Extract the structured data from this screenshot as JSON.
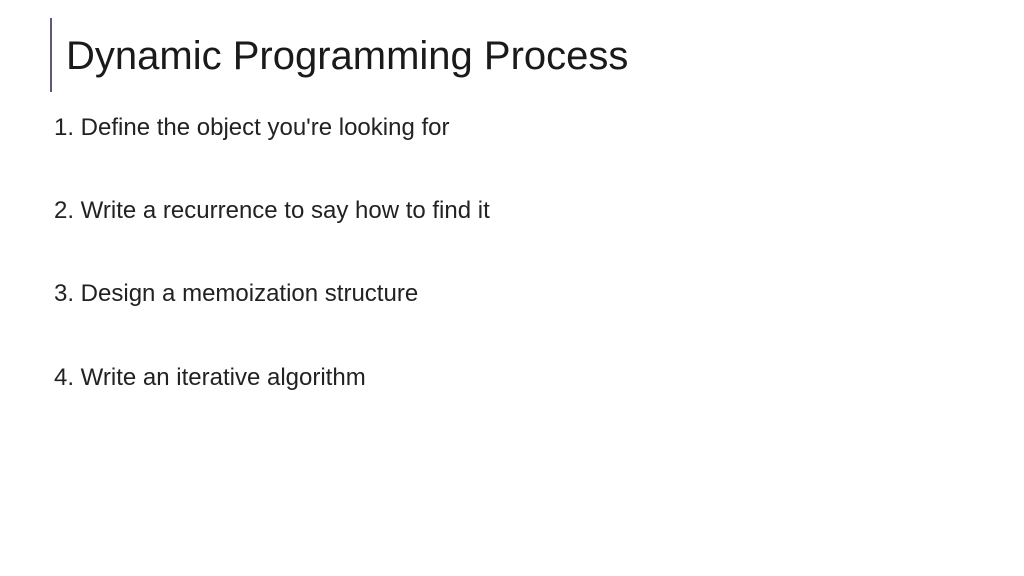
{
  "slide": {
    "title": "Dynamic Programming Process",
    "steps": [
      "1. Define the object you're looking for",
      "2. Write a recurrence to say how to find it",
      "3. Design a memoization structure",
      "4. Write an iterative algorithm"
    ]
  }
}
